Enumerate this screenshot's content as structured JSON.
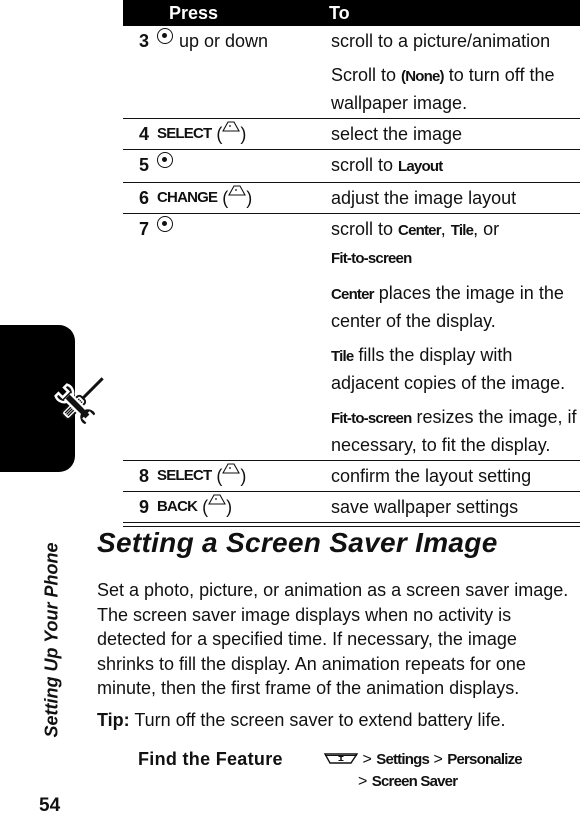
{
  "page": {
    "number": "54",
    "side_title": "Setting Up Your Phone",
    "side_tab_icon": "tools-icon"
  },
  "table": {
    "headers": {
      "press": "Press",
      "to": "To"
    },
    "rows": [
      {
        "num": "3",
        "press": {
          "icon": "nav-key-icon",
          "keyword": "",
          "text": "up or down"
        },
        "to": [
          {
            "parts": [
              {
                "t": "scroll to a picture/animation"
              }
            ]
          },
          {
            "parts": [
              {
                "t": "Scroll to "
              },
              {
                "k": "(None)"
              },
              {
                "t": " to turn off the wallpaper image."
              }
            ]
          }
        ]
      },
      {
        "num": "4",
        "press": {
          "icon": "softkey-icon",
          "keyword": "SELECT",
          "text": ""
        },
        "to": [
          {
            "parts": [
              {
                "t": "select the image"
              }
            ]
          }
        ]
      },
      {
        "num": "5",
        "press": {
          "icon": "nav-key-icon",
          "keyword": "",
          "text": ""
        },
        "to": [
          {
            "parts": [
              {
                "t": "scroll to "
              },
              {
                "k": "Layout"
              }
            ]
          }
        ]
      },
      {
        "num": "6",
        "press": {
          "icon": "softkey-icon",
          "keyword": "CHANGE",
          "text": ""
        },
        "to": [
          {
            "parts": [
              {
                "t": "adjust the image layout"
              }
            ]
          }
        ]
      },
      {
        "num": "7",
        "press": {
          "icon": "nav-key-icon",
          "keyword": "",
          "text": ""
        },
        "to": [
          {
            "parts": [
              {
                "t": "scroll to "
              },
              {
                "k": "Center"
              },
              {
                "t": ", "
              },
              {
                "k": "Tile"
              },
              {
                "t": ", or "
              },
              {
                "br": true
              },
              {
                "k": "Fit-to-screen"
              }
            ]
          },
          {
            "parts": [
              {
                "k": "Center"
              },
              {
                "t": " places the image in the center of the display."
              }
            ]
          },
          {
            "parts": [
              {
                "k": "Tile"
              },
              {
                "t": " fills the display with adjacent copies of the image."
              }
            ]
          },
          {
            "parts": [
              {
                "k": "Fit-to-screen"
              },
              {
                "t": " resizes the image, if necessary, to fit the display."
              }
            ]
          }
        ]
      },
      {
        "num": "8",
        "press": {
          "icon": "softkey-icon",
          "keyword": "SELECT",
          "text": ""
        },
        "to": [
          {
            "parts": [
              {
                "t": "confirm the layout setting"
              }
            ]
          }
        ]
      },
      {
        "num": "9",
        "press": {
          "icon": "softkey-icon",
          "keyword": "BACK",
          "text": ""
        },
        "to": [
          {
            "parts": [
              {
                "t": "save wallpaper settings"
              }
            ]
          }
        ]
      }
    ]
  },
  "section": {
    "heading": "Setting a Screen Saver Image",
    "body": "Set a photo, picture, or animation as a screen saver image. The screen saver image displays when no activity is detected for a specified time. If necessary, the image shrinks to fill the display. An animation repeats for one minute, then the first frame of the animation displays.",
    "tip_label": "Tip:",
    "tip_text": " Turn off the screen saver to extend battery life."
  },
  "find_feature": {
    "label": "Find the Feature",
    "menu_icon": "menu-key-icon",
    "path": [
      "Settings",
      "Personalize",
      "Screen Saver"
    ],
    "separator": ">"
  }
}
